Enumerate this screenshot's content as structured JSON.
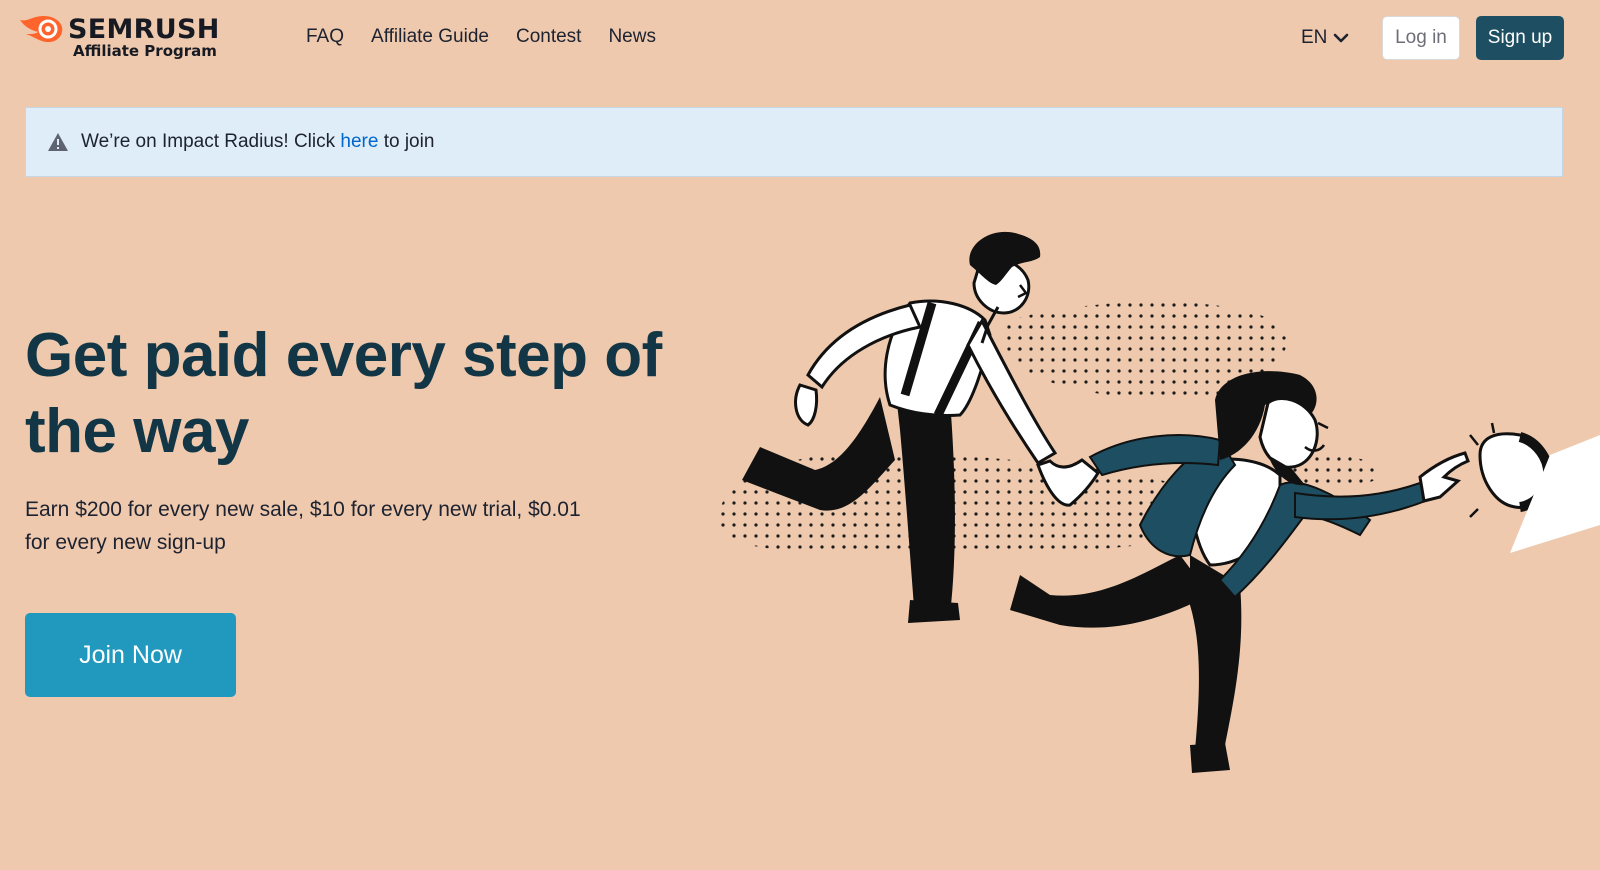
{
  "brand": {
    "name": "SEMRUSH",
    "subtitle": "Affiliate Program",
    "icon": "semrush-flame-icon",
    "accent_color": "#ff642d"
  },
  "nav": {
    "items": [
      {
        "label": "FAQ"
      },
      {
        "label": "Affiliate Guide"
      },
      {
        "label": "Contest"
      },
      {
        "label": "News"
      }
    ]
  },
  "header": {
    "language": "EN",
    "language_icon": "chevron-down-icon",
    "login_label": "Log in",
    "signup_label": "Sign up"
  },
  "banner": {
    "icon": "warning-icon",
    "text_before": "We’re on Impact Radius! Click ",
    "link_text": "here",
    "text_after": " to join"
  },
  "hero": {
    "title": "Get paid every step of the way",
    "subtitle": "Earn $200 for every new sale, $10 for every new trial, $0.01 for every new sign-up",
    "cta_label": "Join Now"
  },
  "colors": {
    "background": "#eec9ad",
    "title": "#123645",
    "cta": "#2198bd",
    "signup": "#1e4e61",
    "banner": "#dfedf8",
    "link": "#0066cc"
  }
}
